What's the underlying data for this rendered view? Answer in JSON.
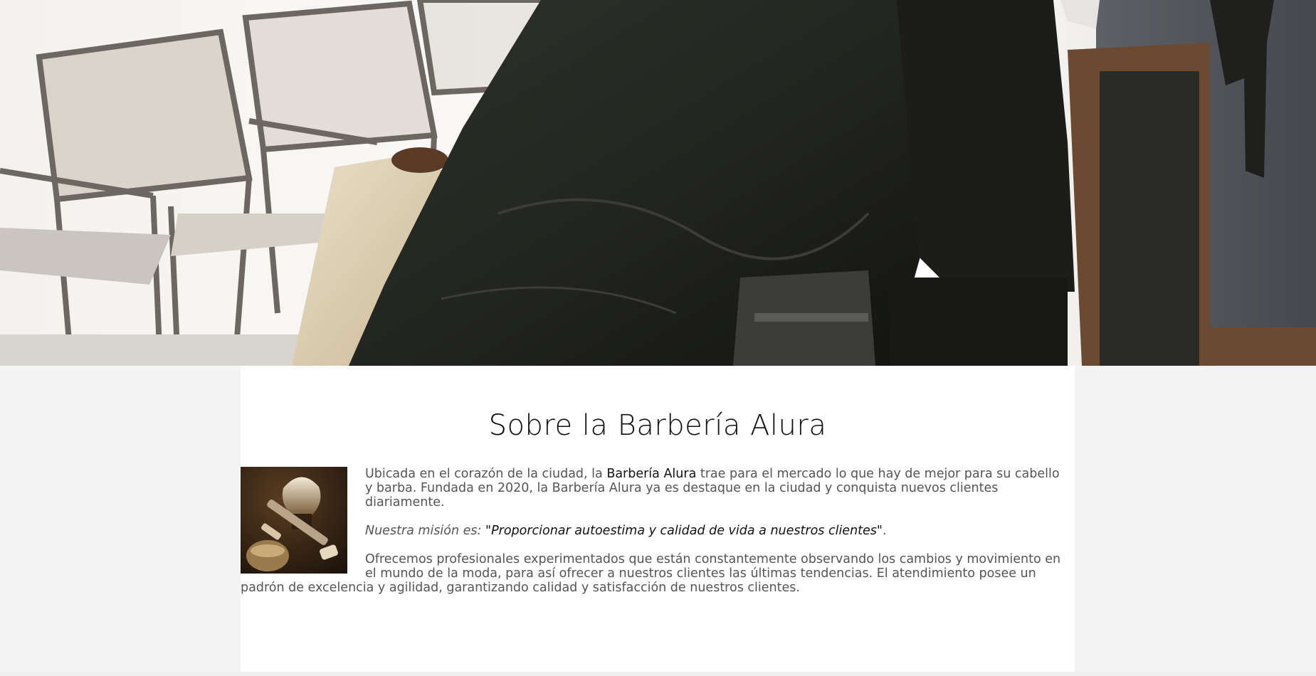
{
  "banner": {
    "alt": "Barbería - cliente sentado con capa"
  },
  "about": {
    "title_first_letter": "S",
    "title_rest": "obre la Barbería Alura",
    "image_alt": "Brocha y navaja de afeitar",
    "p1_before": "Ubicada en el corazón de la ciudad, la ",
    "p1_strong": "Barbería Alura",
    "p1_after": " trae para el mercado lo que hay de mejor para su cabello y barba. Fundada en 2020, la Barbería Alura ya es destaque en la ciudad y conquista nuevos clientes diariamente.",
    "mission_lead": "Nuestra misión es: ",
    "mission_quote": "\"Proporcionar autoestima y calidad de vida a nuestros clientes\"",
    "mission_end": ".",
    "p3": "Ofrecemos profesionales experimentados que están constantemente observando los cambios y movimiento en el mundo de la moda, para así ofrecer a nuestros clientes las últimas tendencias. El atendimiento posee un padrón de excelencia y agilidad, garantizando calidad y satisfacción de nuestros clientes."
  },
  "colors": {
    "text_dark": "#111111",
    "text_body": "#555555",
    "page_background": "#f5f4f4",
    "content_background": "#ffffff"
  }
}
